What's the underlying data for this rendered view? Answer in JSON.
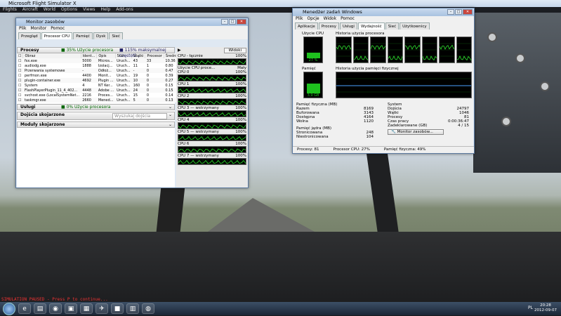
{
  "fsx": {
    "title": "Microsoft Flight Simulator X",
    "menu": [
      "Flights",
      "Aircraft",
      "World",
      "Options",
      "Views",
      "Help",
      "Add-ons"
    ],
    "paused": "SIMULATION PAUSED - Press P to continue..."
  },
  "resmon": {
    "title": "Monitor zasobów",
    "menu": [
      "Plik",
      "Monitor",
      "Pomoc"
    ],
    "tabs": [
      "Przegląd",
      "Procesor CPU",
      "Pamięć",
      "Dysk",
      "Sieć"
    ],
    "active_tab": "Procesor CPU",
    "procesy": {
      "label": "Procesy",
      "usage": "35% Użycie procesora",
      "freq": "115% maksymalnej częstotl..."
    },
    "columns": [
      "Obraz",
      "Ident...",
      "Opis",
      "Stan",
      "Wątki",
      "Procesor",
      "Średni..."
    ],
    "rows": [
      [
        "fsx.exe",
        "5000",
        "Micros...",
        "Uruch...",
        "43",
        "33",
        "10.36"
      ],
      [
        "audiodg.exe",
        "1888",
        "Izolacj...",
        "Uruch...",
        "11",
        "1",
        "0.80"
      ],
      [
        "Przerwania systemowe",
        "-",
        "Odłoż...",
        "Uruch...",
        "-",
        "0",
        "0.47"
      ],
      [
        "perfmon.exe",
        "4400",
        "Monit...",
        "Uruch...",
        "19",
        "0",
        "0.39"
      ],
      [
        "plugin-container.exe",
        "4692",
        "Plugin ...",
        "Uruch...",
        "10",
        "0",
        "0.27"
      ],
      [
        "System",
        "4",
        "NT Ker...",
        "Uruch...",
        "160",
        "0",
        "0.15"
      ],
      [
        "FlashPlayerPlugin_11_4_402...",
        "4448",
        "Adobe ...",
        "Uruch...",
        "24",
        "0",
        "0.15"
      ],
      [
        "svchost.exe (LocalSystemNet...",
        "2216",
        "Proces...",
        "Uruch...",
        "15",
        "0",
        "0.14"
      ],
      [
        "taskmgr.exe",
        "2660",
        "Mened...",
        "Uruch...",
        "5",
        "0",
        "0.13"
      ]
    ],
    "uslugi": {
      "label": "Usługi",
      "usage": "0% Użycie procesora"
    },
    "dojscia": {
      "label": "Dojścia skojarzone",
      "search": "Wyszukaj dojścia"
    },
    "moduly": {
      "label": "Moduły skojarzone"
    },
    "views_btn": "Widoki",
    "graphs": [
      {
        "label": "CPU - łącznie",
        "pct": "100%",
        "note": ""
      },
      {
        "label": "Użycie CPU proce...",
        "pct": "",
        "note": "Mały"
      },
      {
        "label": "CPU 0",
        "pct": "100%",
        "note": ""
      },
      {
        "label": "CPU 1",
        "pct": "100%",
        "note": ""
      },
      {
        "label": "CPU 2",
        "pct": "100%",
        "note": ""
      },
      {
        "label": "CPU 3 — wstrzymany",
        "pct": "100%",
        "note": ""
      },
      {
        "label": "CPU 4",
        "pct": "100%",
        "note": ""
      },
      {
        "label": "CPU 5 — wstrzymany",
        "pct": "100%",
        "note": ""
      },
      {
        "label": "CPU 6",
        "pct": "100%",
        "note": ""
      },
      {
        "label": "CPU 7 — wstrzymany",
        "pct": "100%",
        "note": ""
      }
    ]
  },
  "taskmgr": {
    "title": "Menedżer zadań Windows",
    "menu": [
      "Plik",
      "Opcje",
      "Widok",
      "Pomoc"
    ],
    "tabs": [
      "Aplikacje",
      "Procesy",
      "Usługi",
      "Wydajność",
      "Sieć",
      "Użytkownicy"
    ],
    "active_tab": "Wydajność",
    "cpu_label": "Użycie CPU",
    "cpu_value": "27 %",
    "cpu_hist_label": "Historia użycia procesora",
    "mem_label": "Pamięć",
    "mem_value": "3,9 GB",
    "mem_hist_label": "Historia użycia pamięci fizycznej",
    "phys": {
      "title": "Pamięć fizyczna (MB)",
      "rows": [
        [
          "Razem",
          "8169"
        ],
        [
          "Buforowana",
          "3143"
        ],
        [
          "Dostępna",
          "4164"
        ],
        [
          "Wolna",
          "1120"
        ]
      ]
    },
    "kernel": {
      "title": "Pamięć jądra (MB)",
      "rows": [
        [
          "Stronicowana",
          "248"
        ],
        [
          "Niestronicowana",
          "104"
        ]
      ]
    },
    "system": {
      "title": "System",
      "rows": [
        [
          "Dojścia",
          "24797"
        ],
        [
          "Wątki",
          "1046"
        ],
        [
          "Procesy",
          "81"
        ],
        [
          "Czas pracy",
          "0:00:36:47"
        ],
        [
          "Zadeklarowane (GB)",
          "4 / 15"
        ]
      ]
    },
    "monitor_btn": "Monitor zasobów...",
    "status": [
      "Procesy: 81",
      "Procesor CPU: 27%",
      "Pamięć fizyczna: 49%"
    ]
  },
  "clock": {
    "time": "20:28",
    "date": "2012-09-07"
  },
  "tray": "PL"
}
